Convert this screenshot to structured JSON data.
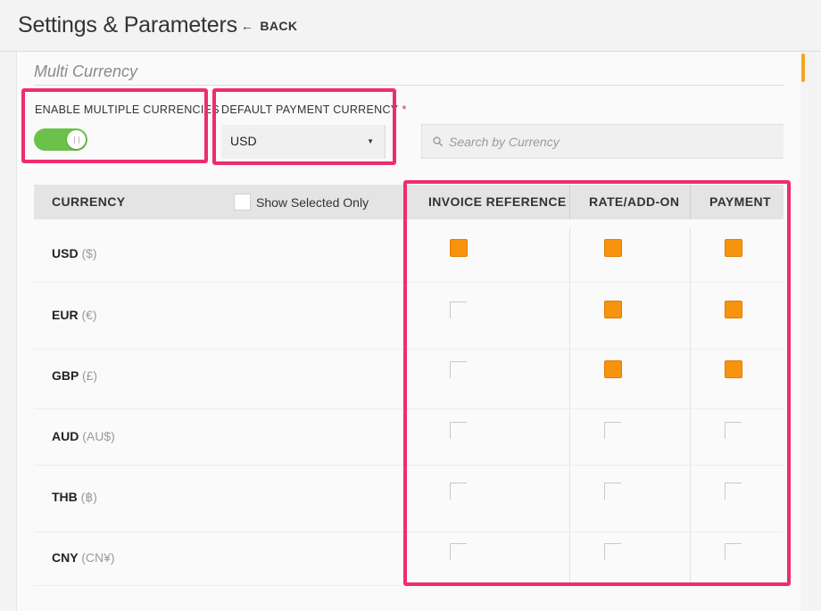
{
  "header": {
    "title": "Settings & Parameters",
    "back_label": "BACK"
  },
  "section": {
    "title": "Multi Currency"
  },
  "enable_multiple": {
    "label": "ENABLE MULTIPLE CURRENCIES",
    "enabled": true
  },
  "default_currency": {
    "label": "DEFAULT PAYMENT CURRENCY",
    "required_mark": "*",
    "value": "USD"
  },
  "search": {
    "placeholder": "Search by Currency"
  },
  "table": {
    "headers": {
      "currency": "CURRENCY",
      "show_selected": "Show Selected Only",
      "invoice": "INVOICE REFERENCE",
      "rate": "RATE/ADD-ON",
      "payment": "PAYMENT"
    },
    "rows": [
      {
        "code": "USD",
        "symbol": "($)",
        "invoice": true,
        "rate": true,
        "payment": true
      },
      {
        "code": "EUR",
        "symbol": "(€)",
        "invoice": false,
        "rate": true,
        "payment": true
      },
      {
        "code": "GBP",
        "symbol": "(£)",
        "invoice": false,
        "rate": true,
        "payment": true
      },
      {
        "code": "AUD",
        "symbol": "(AU$)",
        "invoice": false,
        "rate": false,
        "payment": false
      },
      {
        "code": "THB",
        "symbol": "(฿)",
        "invoice": false,
        "rate": false,
        "payment": false
      },
      {
        "code": "CNY",
        "symbol": "(CN¥)",
        "invoice": false,
        "rate": false,
        "payment": false
      }
    ]
  },
  "colors": {
    "accent": "#f7930d",
    "toggle_on": "#6bc24a",
    "highlight": "#ef2d6b"
  }
}
